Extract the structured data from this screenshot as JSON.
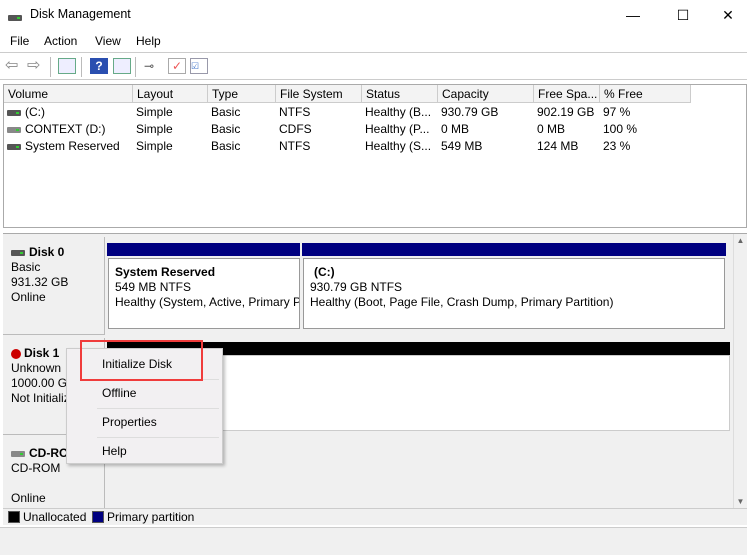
{
  "window": {
    "title": "Disk Management",
    "minimize": "—",
    "maximize": "☐",
    "close": "✕"
  },
  "menu": [
    "File",
    "Action",
    "View",
    "Help"
  ],
  "toolbar": [
    "back-icon",
    "forward-icon",
    "console-tree-icon",
    "help-icon",
    "action-pane-icon",
    "connect-icon",
    "check-icon",
    "properties-icon"
  ],
  "columns": [
    "Volume",
    "Layout",
    "Type",
    "File System",
    "Status",
    "Capacity",
    "Free Spa...",
    "% Free"
  ],
  "volumes": [
    {
      "icon": "drive-icon",
      "cells": [
        "(C:)",
        "Simple",
        "Basic",
        "NTFS",
        "Healthy (B...",
        "930.79 GB",
        "902.19 GB",
        "97 %"
      ]
    },
    {
      "icon": "cdrom-icon",
      "cells": [
        "CONTEXT (D:)",
        "Simple",
        "Basic",
        "CDFS",
        "Healthy (P...",
        "0 MB",
        "0 MB",
        "100 %"
      ]
    },
    {
      "icon": "drive-icon",
      "cells": [
        "System Reserved",
        "Simple",
        "Basic",
        "NTFS",
        "Healthy (S...",
        "549 MB",
        "124 MB",
        "23 %"
      ]
    }
  ],
  "disks": [
    {
      "name": "Disk 0",
      "type": "Basic",
      "size": "931.32 GB",
      "state": "Online",
      "partitions": [
        {
          "name": "System Reserved",
          "size": "549 MB NTFS",
          "status": "Healthy (System, Active, Primary Partition)"
        },
        {
          "name": "(C:)",
          "size": "930.79 GB NTFS",
          "status": "Healthy (Boot, Page File, Crash Dump, Primary Partition)"
        }
      ]
    },
    {
      "name": "Disk 1",
      "type": "Unknown",
      "size": "1000.00 GB",
      "state": "Not Initialized"
    },
    {
      "name": "CD-ROM 0",
      "type": "CD-ROM",
      "size": "",
      "state": "Online"
    }
  ],
  "context_menu": [
    "Initialize Disk",
    "Offline",
    "Properties",
    "Help"
  ],
  "legend": [
    {
      "label": "Unallocated",
      "color": "#000000"
    },
    {
      "label": "Primary partition",
      "color": "#000080"
    }
  ],
  "colors": {
    "primary": "#000080",
    "unallocated": "#000000",
    "highlight": "#f03c3c"
  }
}
